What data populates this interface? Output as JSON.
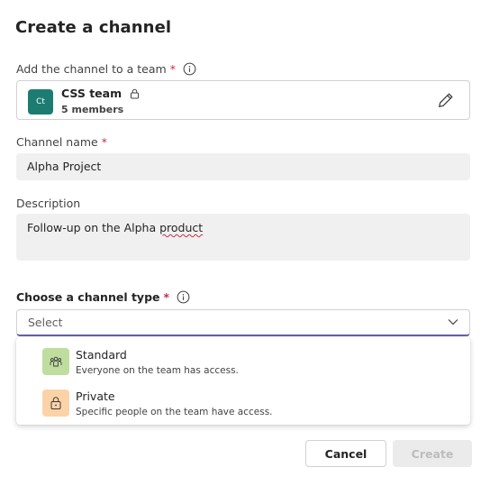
{
  "dialog": {
    "title": "Create a channel",
    "team_field": {
      "label": "Add the channel to a team",
      "required_mark": "*",
      "team": {
        "avatar_text": "Ct",
        "avatar_color": "#1c7c72",
        "name": "CSS team",
        "members": "5 members"
      }
    },
    "name_field": {
      "label": "Channel name",
      "required_mark": "*",
      "value": "Alpha Project"
    },
    "description_field": {
      "label": "Description",
      "value_prefix": "Follow-up on the Alpha ",
      "value_misspelled": "product"
    },
    "type_field": {
      "label": "Choose a channel type",
      "required_mark": "*",
      "placeholder": "Select",
      "options": [
        {
          "title": "Standard",
          "description": "Everyone on the team has access.",
          "icon": "team-icon",
          "icon_bg": "#bfdd9e"
        },
        {
          "title": "Private",
          "description": "Specific people on the team have access.",
          "icon": "lock-icon",
          "icon_bg": "#fcd3a7"
        }
      ]
    },
    "buttons": {
      "cancel": "Cancel",
      "create": "Create"
    },
    "colors": {
      "accent": "#6264a7",
      "required": "#c4314b"
    }
  }
}
